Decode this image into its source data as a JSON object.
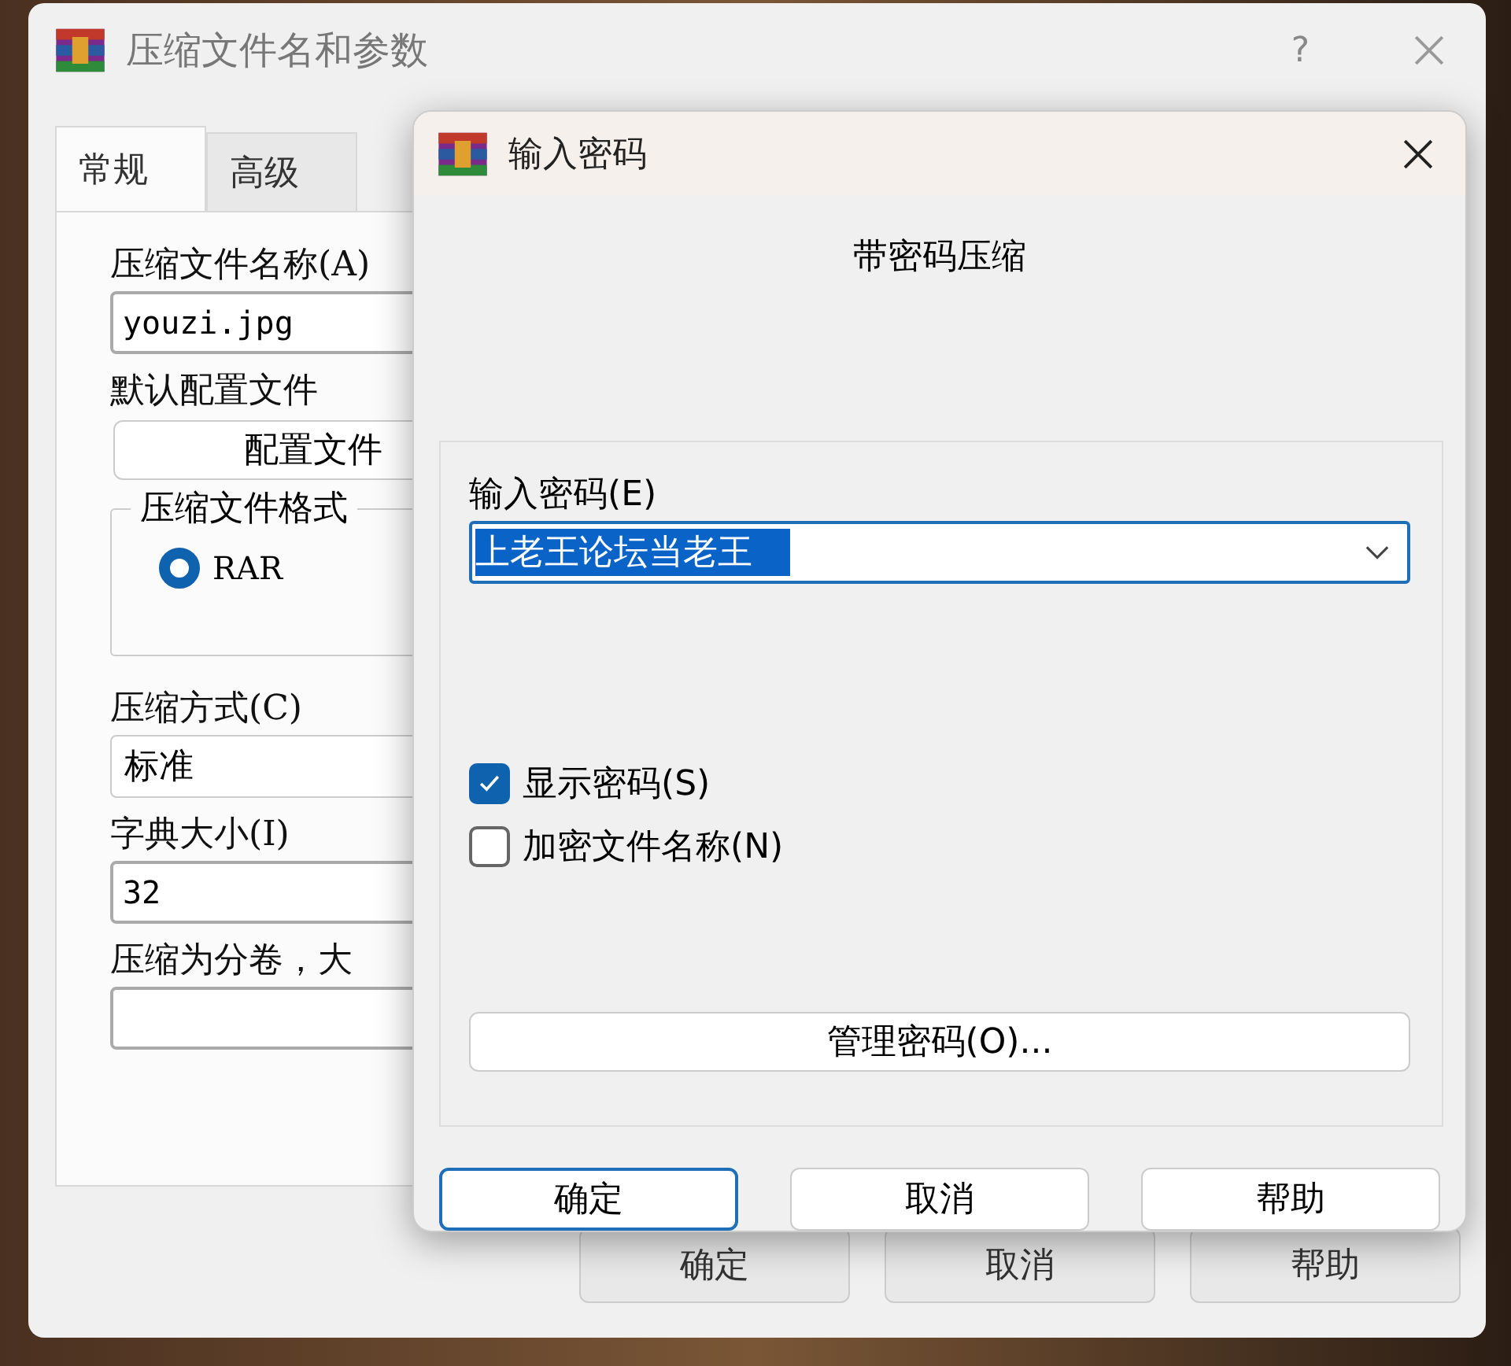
{
  "main_window": {
    "title": "压缩文件名和参数",
    "help_button": "?",
    "tabs": [
      {
        "label": "常规",
        "selected": true
      },
      {
        "label": "高级",
        "selected": false
      }
    ],
    "controls": [
      {
        "kind": "label",
        "text": "压缩文件名称(A)"
      },
      {
        "kind": "text_field",
        "value": "youzi.jpg"
      },
      {
        "kind": "label",
        "text": "默认配置文件"
      },
      {
        "kind": "button",
        "text": "配置文件"
      },
      {
        "kind": "group",
        "title": "压缩文件格式",
        "options": [
          {
            "label": "RAR",
            "selected": true
          }
        ]
      },
      {
        "kind": "label",
        "text": "压缩方式(C)"
      },
      {
        "kind": "dropdown",
        "value": "标准"
      },
      {
        "kind": "label",
        "text": "字典大小(I)"
      },
      {
        "kind": "text_field",
        "value": "32"
      },
      {
        "kind": "label",
        "text": "压缩为分卷，大"
      },
      {
        "kind": "text_field"
      }
    ],
    "buttons": [
      {
        "label": "确定"
      },
      {
        "label": "取消"
      },
      {
        "label": "帮助"
      }
    ]
  },
  "password_dialog": {
    "title": "输入密码",
    "heading": "带密码压缩",
    "password": {
      "label": "输入密码(E)",
      "value": "上老王论坛当老王",
      "text_selected": true
    },
    "checkboxes": [
      {
        "label": "显示密码(S)",
        "checked": true
      },
      {
        "label": "加密文件名称(N)",
        "checked": false
      }
    ],
    "manage_button": "管理密码(O)...",
    "buttons": [
      {
        "label": "确定",
        "default": true
      },
      {
        "label": "取消",
        "default": false
      },
      {
        "label": "帮助",
        "default": false
      }
    ]
  }
}
